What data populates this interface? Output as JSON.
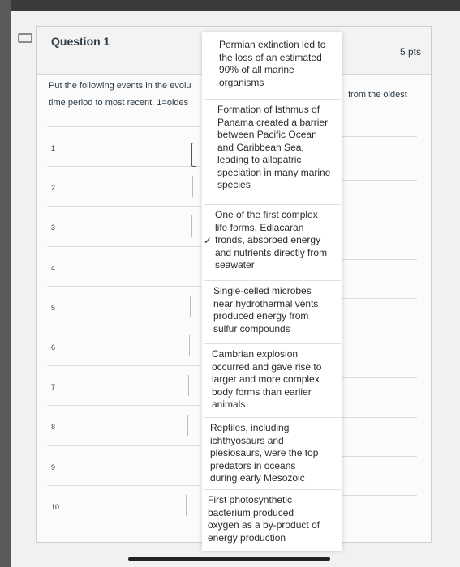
{
  "question": {
    "title": "Question 1",
    "points": "5 pts",
    "prompt_line1": "Put the following events in the evolu",
    "prompt_line2": "time period to most recent.  1=oldes",
    "prompt_right": "from the oldest"
  },
  "slots": [
    "1",
    "2",
    "3",
    "4",
    "5",
    "6",
    "7",
    "8",
    "9",
    "10"
  ],
  "dropdown": {
    "selected_index": 2,
    "checkmark": "✓",
    "options": [
      {
        "lines": [
          "Permian extinction led to",
          "the loss of an estimated",
          "90% of all marine",
          "organisms"
        ]
      },
      {
        "lines": [
          "Formation of Isthmus of",
          "Panama created a barrier",
          "between Pacific Ocean",
          "and Caribbean Sea,",
          "leading to allopatric",
          "speciation in many marine",
          "species"
        ]
      },
      {
        "lines": [
          "One of the first complex",
          "life forms, Ediacaran",
          "fronds, absorbed energy",
          "and nutrients directly from",
          "seawater"
        ]
      },
      {
        "lines": [
          "Single-celled microbes",
          "near hydrothermal vents",
          "produced energy from",
          "sulfur compounds"
        ]
      },
      {
        "lines": [
          "Cambrian explosion",
          "occurred and gave rise to",
          "larger and more complex",
          "body forms than earlier",
          "animals"
        ]
      },
      {
        "lines": [
          "Reptiles, including",
          "ichthyosaurs and",
          "plesiosaurs, were the top",
          "predators in oceans",
          "during early Mesozoic"
        ]
      },
      {
        "lines": [
          "First photosynthetic",
          "bacterium produced",
          "oxygen as a by-product of",
          "energy production"
        ]
      }
    ]
  }
}
